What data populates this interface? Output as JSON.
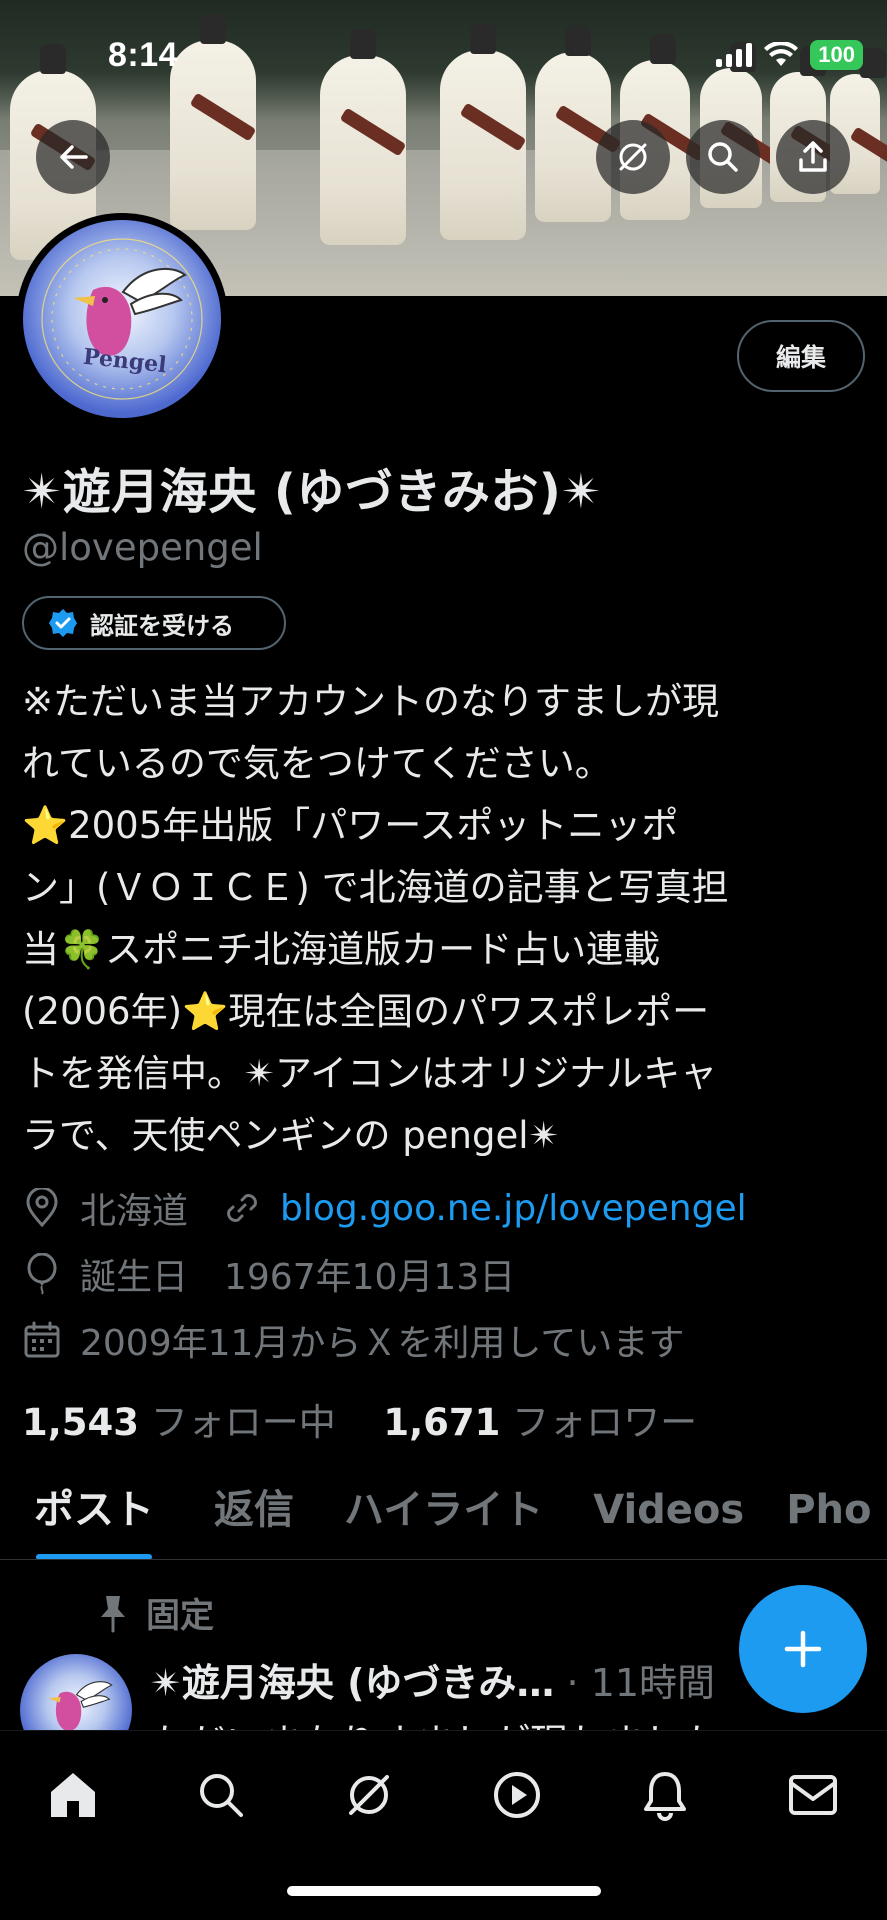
{
  "status_bar": {
    "time": "8:14",
    "battery": "100"
  },
  "profile": {
    "name": "✴︎遊月海央 (ゆづきみお)✴︎",
    "handle": "@lovepengel",
    "edit_label": "編集",
    "verify_label": "認証を受ける",
    "avatar_text": "Pengel",
    "bio": "※ただいま当アカウントのなりすましが現\nれているので気をつけてください。\n⭐2005年出版「パワースポットニッポ\nン」(ＶＯＩＣＥ) で北海道の記事と写真担\n当🍀スポニチ北海道版カード占い連載\n(2006年)⭐現在は全国のパワスポレポー\nトを発信中。✴︎アイコンはオリジナルキャ\nラで、天使ペンギンの pengel✴︎",
    "location": "北海道",
    "website": "blog.goo.ne.jp/lovepengel",
    "birthday": "誕生日　1967年10月13日",
    "joined": "2009年11月からＸを利用しています",
    "following_count": "1,543",
    "following_label": "フォロー中",
    "followers_count": "1,671",
    "followers_label": "フォロワー"
  },
  "tabs": [
    {
      "label": "ポスト",
      "active": true
    },
    {
      "label": "返信",
      "active": false
    },
    {
      "label": "ハイライト",
      "active": false
    },
    {
      "label": "Videos",
      "active": false
    },
    {
      "label": "Pho",
      "active": false
    }
  ],
  "pinned_post": {
    "pinned_label": "固定",
    "author": "✴︎遊月海央 (ゆづきみ…",
    "time": "· 11時間",
    "text": "ただいまなりすましが現れました"
  },
  "icons": {
    "back": "back-arrow-icon",
    "grok": "grok-icon",
    "search": "search-icon",
    "share": "share-icon",
    "location": "location-pin-icon",
    "link": "link-icon",
    "birthday": "balloon-icon",
    "calendar": "calendar-icon",
    "verified": "verified-badge-icon",
    "pin": "pin-icon",
    "compose": "plus-icon",
    "nav": [
      "home-icon",
      "search-icon",
      "grok-icon",
      "play-icon",
      "bell-icon",
      "mail-icon"
    ]
  },
  "colors": {
    "accent": "#1d9bf0",
    "muted": "#71767b",
    "battery": "#35c759"
  }
}
